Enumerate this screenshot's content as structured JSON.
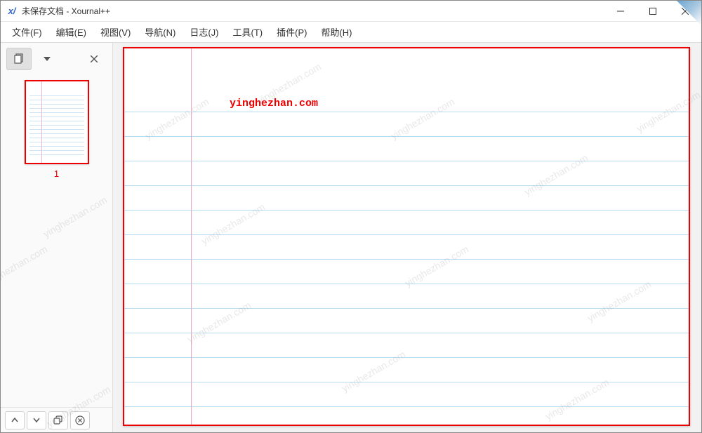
{
  "window": {
    "app_icon_text": "x/",
    "title": "未保存文档 - Xournal++"
  },
  "menu": {
    "file": "文件(F)",
    "edit": "编辑(E)",
    "view": "视图(V)",
    "navigate": "导航(N)",
    "journal": "日志(J)",
    "tools": "工具(T)",
    "plugins": "插件(P)",
    "help": "帮助(H)"
  },
  "sidebar": {
    "page_number": "1"
  },
  "canvas": {
    "watermark_text": "yinghezhan.com"
  },
  "bg_watermark": "yinghezhan.com"
}
